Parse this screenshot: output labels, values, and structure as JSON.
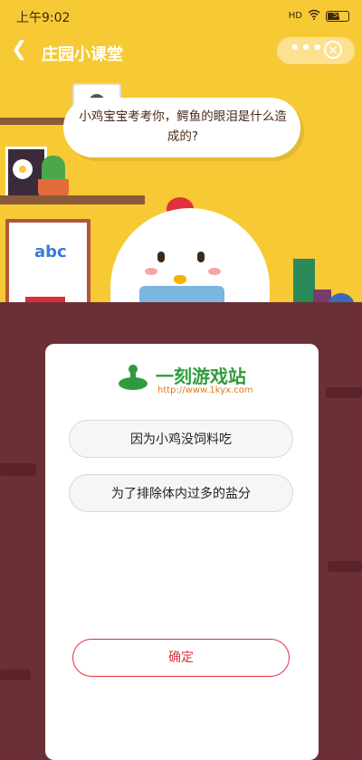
{
  "status_bar": {
    "time": "上午9:02",
    "signal": "HD",
    "battery": "56"
  },
  "header": {
    "title": "庄园小课堂",
    "menu_icon": "more-dots-icon",
    "close_icon": "close-circle-icon"
  },
  "question": {
    "text": "小鸡宝宝考考你，鳄鱼的眼泪是什么造成的?"
  },
  "board": {
    "letters": "abc"
  },
  "card": {
    "logo_text": "一刻游戏站",
    "logo_url": "http://www.1kyx.com",
    "options": [
      {
        "label": "因为小鸡没饲料吃"
      },
      {
        "label": "为了排除体内过多的盐分"
      }
    ],
    "confirm_label": "确定"
  },
  "colors": {
    "scene_bg": "#f7c935",
    "wall": "#6b3036",
    "accent_red": "#e0313c",
    "logo_green": "#2f9b3e"
  }
}
